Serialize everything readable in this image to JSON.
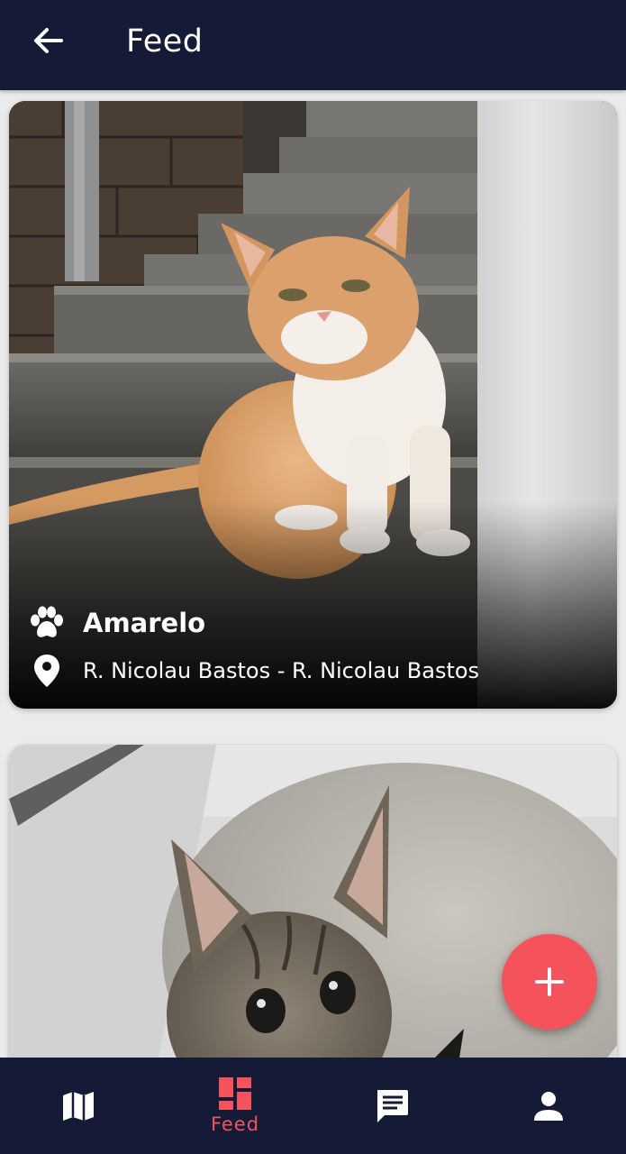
{
  "header": {
    "title": "Feed",
    "back_icon": "arrow-left-icon"
  },
  "feed": {
    "posts": [
      {
        "name": "Amarelo",
        "address": "R. Nicolau Bastos - R. Nicolau Bastos",
        "name_icon": "paw-icon",
        "address_icon": "location-pin-icon"
      },
      {
        "name": "",
        "address": ""
      }
    ]
  },
  "fab": {
    "icon": "plus-icon"
  },
  "bottom_nav": {
    "items": [
      {
        "icon": "map-icon",
        "label": ""
      },
      {
        "icon": "feed-icon",
        "label": "Feed",
        "active": true
      },
      {
        "icon": "chat-icon",
        "label": ""
      },
      {
        "icon": "profile-icon",
        "label": ""
      }
    ]
  },
  "colors": {
    "primary": "#151a37",
    "accent": "#f4535b",
    "background": "#ebebeb"
  }
}
